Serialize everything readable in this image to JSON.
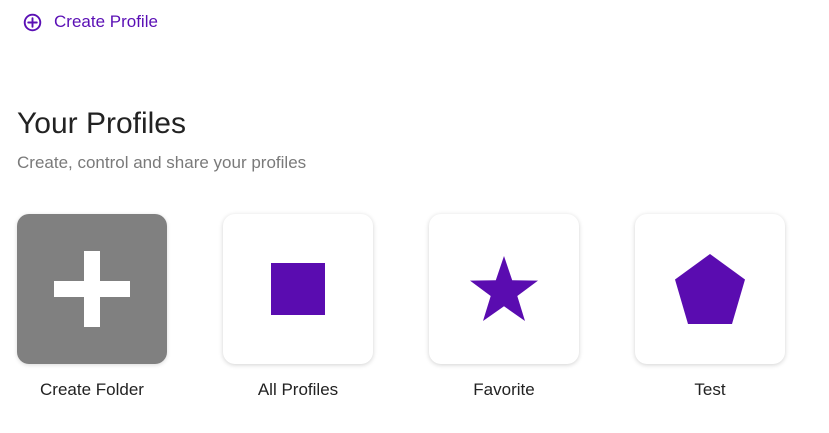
{
  "header": {
    "create_profile_label": "Create Profile",
    "create_profile_icon": "plus-circle-icon"
  },
  "section": {
    "title": "Your Profiles",
    "subtitle": "Create, control and share your profiles"
  },
  "tiles": [
    {
      "label": "Create Folder",
      "icon": "plus-icon",
      "background": "#808080"
    },
    {
      "label": "All Profiles",
      "icon": "square-icon",
      "background": "#ffffff"
    },
    {
      "label": "Favorite",
      "icon": "star-icon",
      "background": "#ffffff"
    },
    {
      "label": "Test",
      "icon": "pentagon-icon",
      "background": "#ffffff"
    }
  ],
  "colors": {
    "accent": "#5a0fb5",
    "icon_fill": "#5a0cb0",
    "text": "#222222",
    "muted_text": "#7a7a7a"
  }
}
